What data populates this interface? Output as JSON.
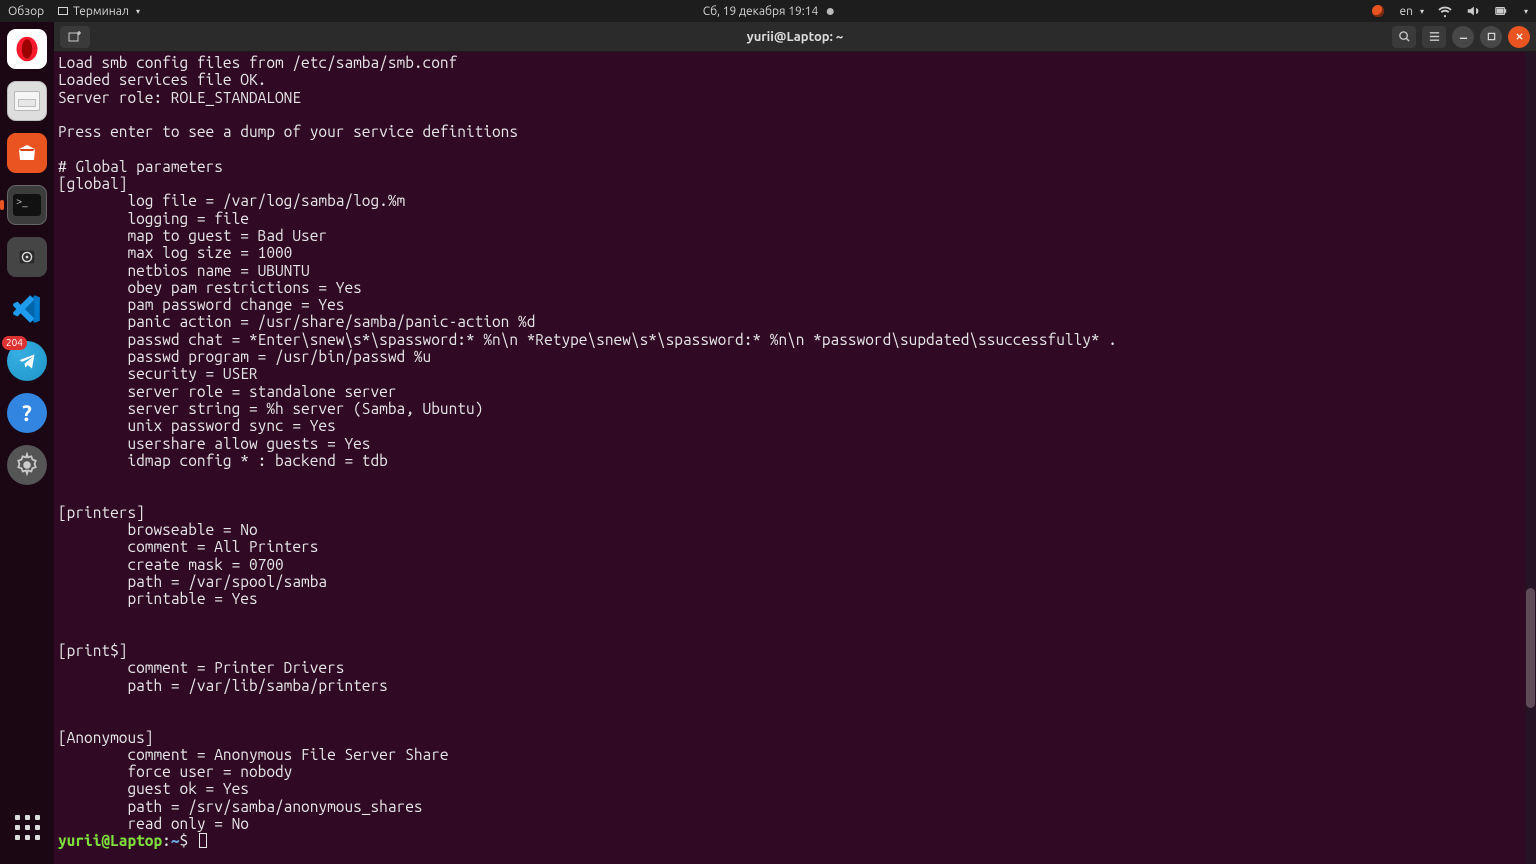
{
  "topbar": {
    "activities": "Обзор",
    "app_menu": "Терминал",
    "clock": "Сб, 19 декабря  19:14",
    "lang": "en"
  },
  "launcher": {
    "telegram_badge": "204"
  },
  "window": {
    "title": "yurii@Laptop: ~"
  },
  "terminal": {
    "lines": [
      "Load smb config files from /etc/samba/smb.conf",
      "Loaded services file OK.",
      "Server role: ROLE_STANDALONE",
      "",
      "Press enter to see a dump of your service definitions",
      "",
      "# Global parameters",
      "[global]",
      "        log file = /var/log/samba/log.%m",
      "        logging = file",
      "        map to guest = Bad User",
      "        max log size = 1000",
      "        netbios name = UBUNTU",
      "        obey pam restrictions = Yes",
      "        pam password change = Yes",
      "        panic action = /usr/share/samba/panic-action %d",
      "        passwd chat = *Enter\\snew\\s*\\spassword:* %n\\n *Retype\\snew\\s*\\spassword:* %n\\n *password\\supdated\\ssuccessfully* .",
      "        passwd program = /usr/bin/passwd %u",
      "        security = USER",
      "        server role = standalone server",
      "        server string = %h server (Samba, Ubuntu)",
      "        unix password sync = Yes",
      "        usershare allow guests = Yes",
      "        idmap config * : backend = tdb",
      "",
      "",
      "[printers]",
      "        browseable = No",
      "        comment = All Printers",
      "        create mask = 0700",
      "        path = /var/spool/samba",
      "        printable = Yes",
      "",
      "",
      "[print$]",
      "        comment = Printer Drivers",
      "        path = /var/lib/samba/printers",
      "",
      "",
      "[Anonymous]",
      "        comment = Anonymous File Server Share",
      "        force user = nobody",
      "        guest ok = Yes",
      "        path = /srv/samba/anonymous_shares",
      "        read only = No"
    ],
    "prompt": {
      "user_host": "yurii@Laptop",
      "sep": ":",
      "path": "~",
      "symbol": "$"
    }
  }
}
